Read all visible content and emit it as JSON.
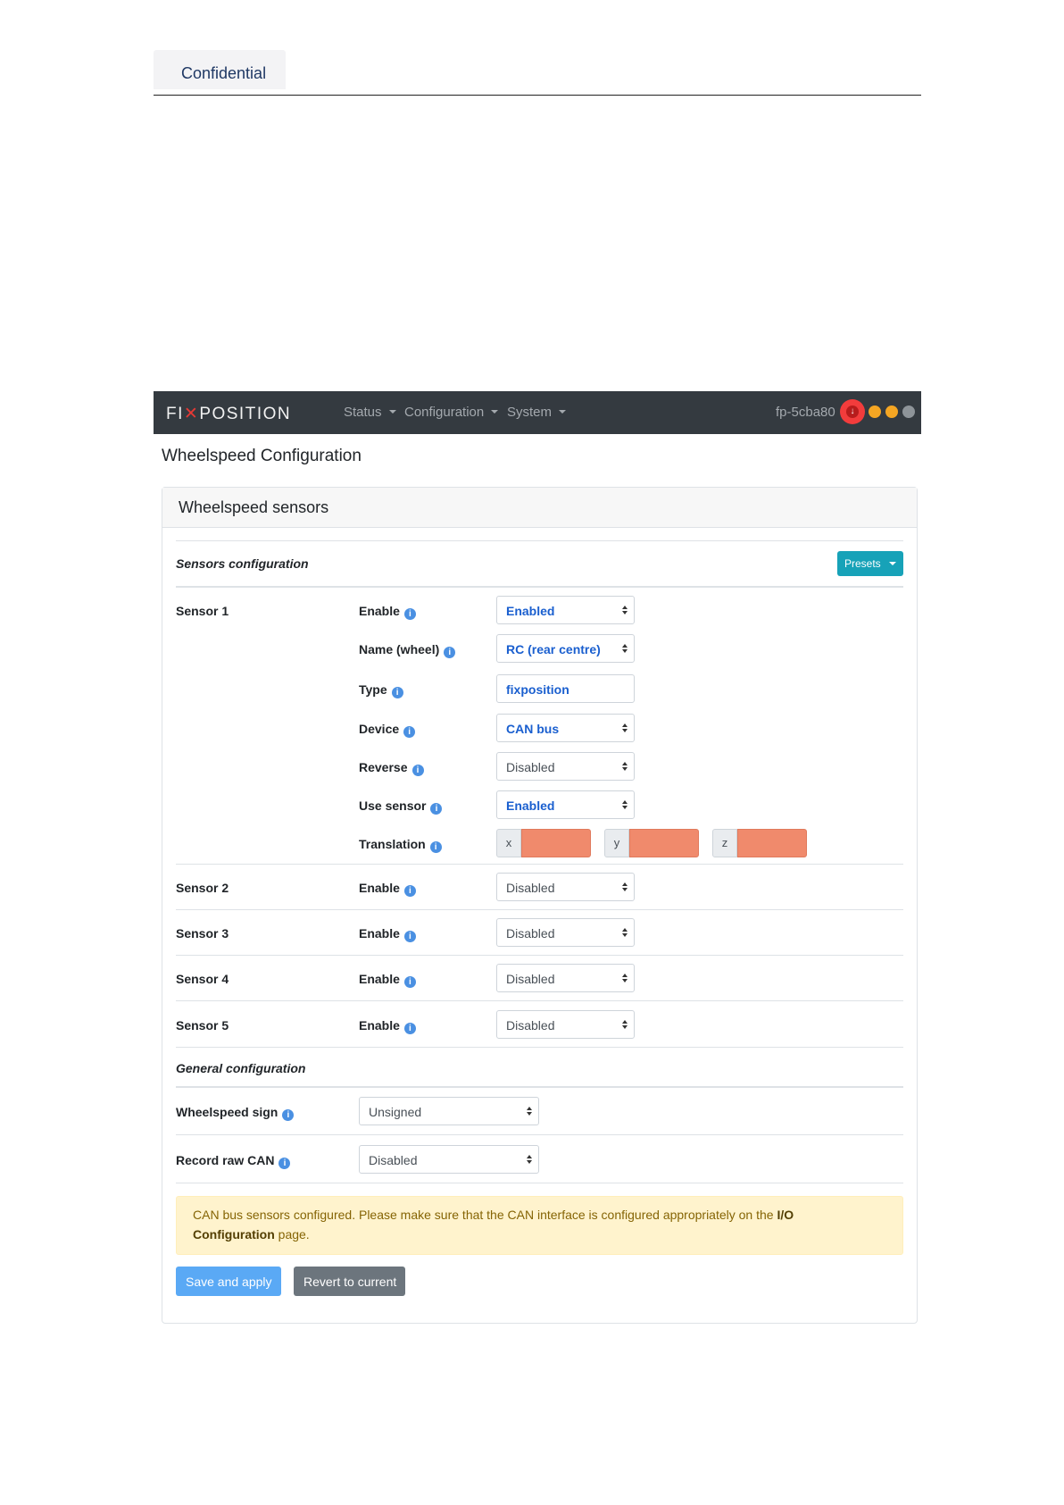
{
  "document": {
    "confidential_label": "Confidential"
  },
  "navbar": {
    "brand_pre": "FI",
    "brand_x": "✕",
    "brand_post": "POSITION",
    "menu": [
      {
        "label": "Status"
      },
      {
        "label": "Configuration"
      },
      {
        "label": "System"
      }
    ],
    "hostname": "fp-5cba80",
    "status_indicators": [
      "red-alert",
      "orange",
      "orange",
      "gray"
    ],
    "colors": {
      "red": "#f23c3c",
      "orange": "#f5a623",
      "gray": "#8e9499"
    }
  },
  "page_title": "Wheelspeed Configuration",
  "card": {
    "title": "Wheelspeed sensors",
    "sensors_section_title": "Sensors configuration",
    "presets_label": "Presets",
    "sensor1": {
      "label": "Sensor 1",
      "enable": {
        "label": "Enable",
        "value": "Enabled"
      },
      "name": {
        "label": "Name (wheel)",
        "value": "RC (rear centre)"
      },
      "type": {
        "label": "Type",
        "value": "fixposition"
      },
      "device": {
        "label": "Device",
        "value": "CAN bus"
      },
      "reverse": {
        "label": "Reverse",
        "value": "Disabled"
      },
      "use_sensor": {
        "label": "Use sensor",
        "value": "Enabled"
      },
      "translation": {
        "label": "Translation",
        "axes": [
          "x",
          "y",
          "z"
        ]
      }
    },
    "other_sensors": [
      {
        "label": "Sensor 2",
        "enable_label": "Enable",
        "value": "Disabled"
      },
      {
        "label": "Sensor 3",
        "enable_label": "Enable",
        "value": "Disabled"
      },
      {
        "label": "Sensor 4",
        "enable_label": "Enable",
        "value": "Disabled"
      },
      {
        "label": "Sensor 5",
        "enable_label": "Enable",
        "value": "Disabled"
      }
    ],
    "general_section_title": "General configuration",
    "wheelspeed_sign": {
      "label": "Wheelspeed sign",
      "value": "Unsigned"
    },
    "record_raw_can": {
      "label": "Record raw CAN",
      "value": "Disabled"
    },
    "alert": {
      "text1": "CAN bus sensors configured. Please make sure that the CAN interface is configured appropriately on the ",
      "bold1": "I/O",
      "bold2": "Configuration",
      "text2": " page."
    },
    "save_label": "Save and apply",
    "revert_label": "Revert to current"
  },
  "info_icon_glyph": "i"
}
